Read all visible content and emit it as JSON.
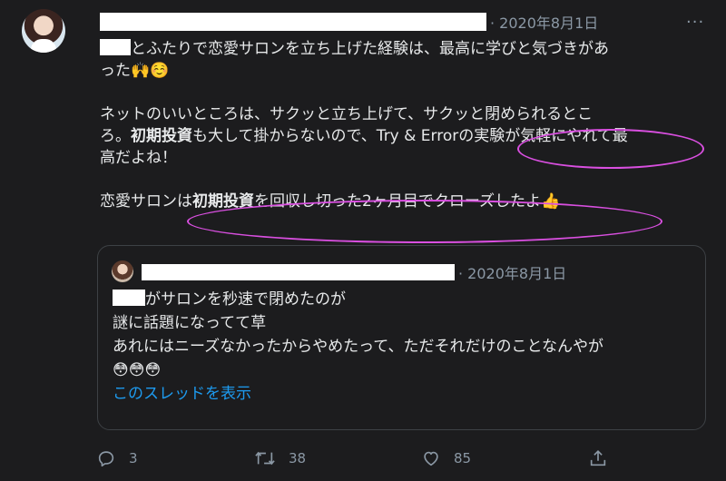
{
  "tweet": {
    "date": "· 2020年8月1日",
    "more_label": "···",
    "p1_line1_after": "とふたりで恋愛サロンを立ち上げた経験は、最高に学びと気づきがあ",
    "p1_line2": "った",
    "p1_emoji": "🙌☺️",
    "p2_line1": "ネットのいいところは、サクッと立ち上げて、サクッと閉められるとこ",
    "p2_line2_a": "ろ。",
    "p2_bold": "初期投資",
    "p2_line2_b": "も大して掛からないので、Try & Errorの実験が気軽にやれて最",
    "p2_line3": "高だよね！",
    "p3_a": "恋愛サロンは",
    "p3_bold": "初期投資",
    "p3_b": "を回収し切った2ヶ月目でクローズしたよ",
    "p3_emoji": "👍"
  },
  "quote": {
    "date": "· 2020年8月1日",
    "line1": "がサロンを秒速で閉めたのが",
    "line2": "謎に話題になってて草",
    "line3": "あれにはニーズなかったからやめたって、ただそれだけのことなんやが",
    "emoji": "😳😳😳",
    "show_thread": "このスレッドを表示"
  },
  "actions": {
    "replies": "3",
    "retweets": "38",
    "likes": "85"
  },
  "colors": {
    "background": "#1c1c1e",
    "muted": "#8b98a5",
    "link": "#1d9bf0",
    "annotation": "#d94fe0"
  }
}
